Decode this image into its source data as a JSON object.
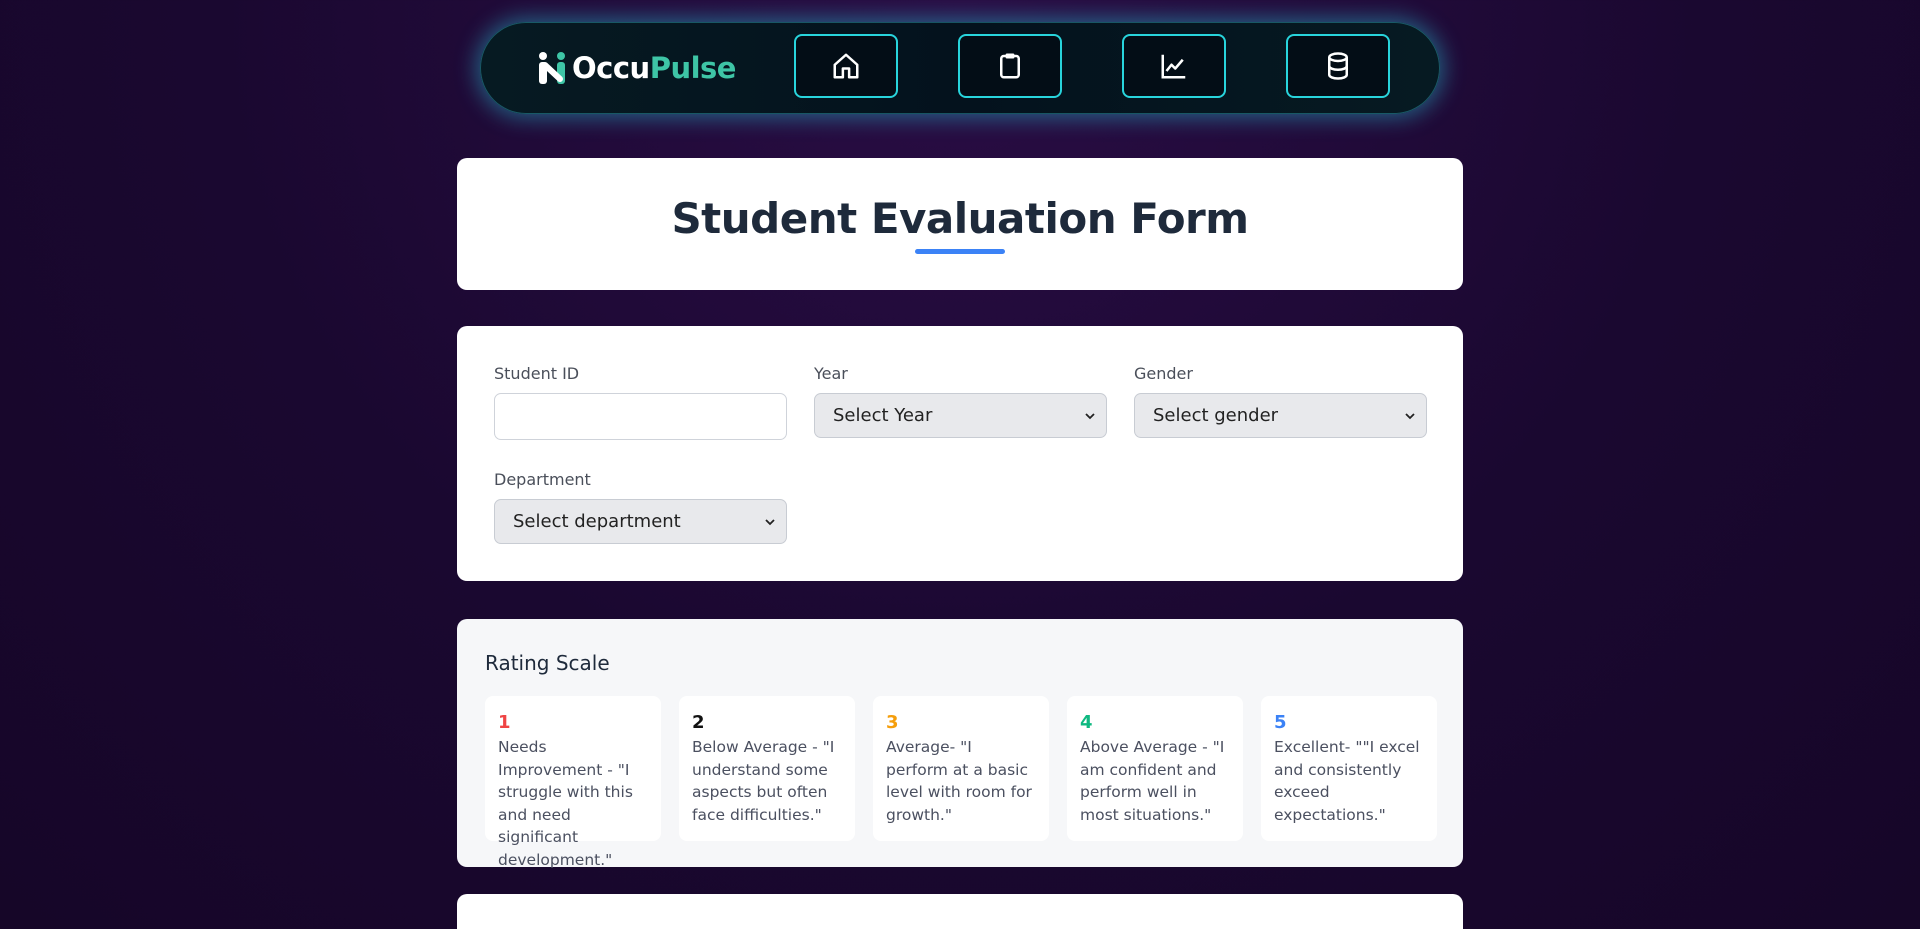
{
  "nav": {
    "brand_part1": "Occu",
    "brand_part2": "Pulse",
    "buttons": [
      {
        "icon": "home-icon"
      },
      {
        "icon": "clipboard-icon"
      },
      {
        "icon": "chart-line-icon"
      },
      {
        "icon": "database-icon"
      }
    ]
  },
  "header": {
    "title": "Student Evaluation Form"
  },
  "form": {
    "student_id_label": "Student ID",
    "student_id_value": "",
    "year_label": "Year",
    "year_value": "Select Year",
    "gender_label": "Gender",
    "gender_value": "Select gender",
    "department_label": "Department",
    "department_value": "Select department"
  },
  "rating_scale": {
    "title": "Rating Scale",
    "items": [
      {
        "number": "1",
        "text": "Needs Improvement - \"I struggle with this and need significant development.\"",
        "color": "#ef4444"
      },
      {
        "number": "2",
        "text": "Below Average - \"I understand some aspects but often face difficulties.\"",
        "color": "#111111"
      },
      {
        "number": "3",
        "text": "Average- \"I perform at a basic level with room for growth.\"",
        "color": "#f59e0b"
      },
      {
        "number": "4",
        "text": "Above Average - \"I am confident and perform well in most situations.\"",
        "color": "#10b981"
      },
      {
        "number": "5",
        "text": "Excellent- \"\"I excel and consistently exceed expectations.\"",
        "color": "#3b82f6"
      }
    ]
  },
  "colors": {
    "accent": "#3b82f6",
    "nav_border": "#28d4dc",
    "brand_green": "#3ec5a6"
  }
}
